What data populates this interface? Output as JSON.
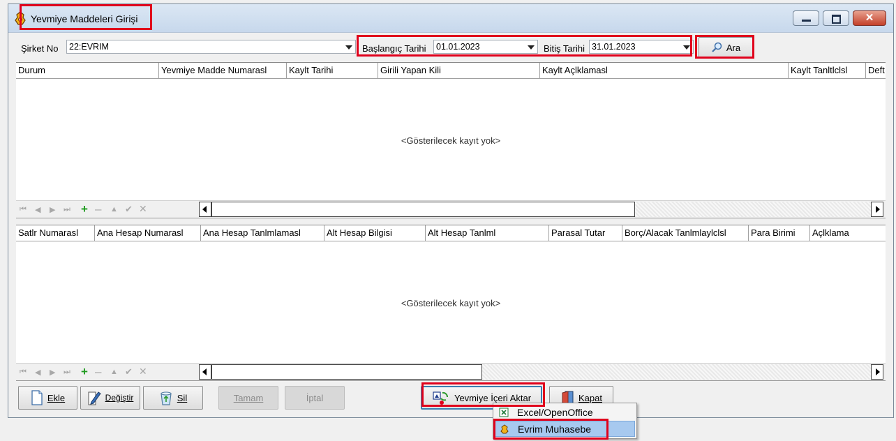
{
  "window": {
    "title": "Yevmiye Maddeleri Girişi"
  },
  "filters": {
    "sirket_label": "Şirket No",
    "sirket_value": "22:EVRIM",
    "baslangic_label": "Başlangıç Tarihi",
    "baslangic_value": "01.01.2023",
    "bitis_label": "Bitiş Tarihi",
    "bitis_value": "31.01.2023",
    "search_label": "Ara"
  },
  "top_grid": {
    "columns": [
      "Durum",
      "Yevmiye Madde Numarasl",
      "Kaylt Tarihi",
      "Girili Yapan Kili",
      "Kaylt Açlklamasl",
      "Kaylt Tanltlclsl",
      "Deft"
    ],
    "empty_text": "<Gösterilecek kayıt yok>"
  },
  "bottom_grid": {
    "columns": [
      "Satlr Numarasl",
      "Ana Hesap Numarasl",
      "Ana Hesap Tanlmlamasl",
      "Alt Hesap Bilgisi",
      "Alt Hesap Tanlml",
      "Parasal Tutar",
      "Borç/Alacak Tanlmlaylclsl",
      "Para Birimi",
      "Açlklama"
    ],
    "empty_text": "<Gösterilecek kayıt yok>"
  },
  "buttons": {
    "ekle": "Ekle",
    "degistir": "Değiştir",
    "sil": "Sil",
    "tamam": "Tamam",
    "iptal": "İptal",
    "import": "Yevmiye İçeri Aktar",
    "kapat": "Kapat"
  },
  "import_menu": {
    "items": [
      "Excel/OpenOffice",
      "Evrim Muhasebe"
    ]
  },
  "colors": {
    "highlight_box": "#e0001b",
    "menu_highlight": "#a7c9ef"
  }
}
